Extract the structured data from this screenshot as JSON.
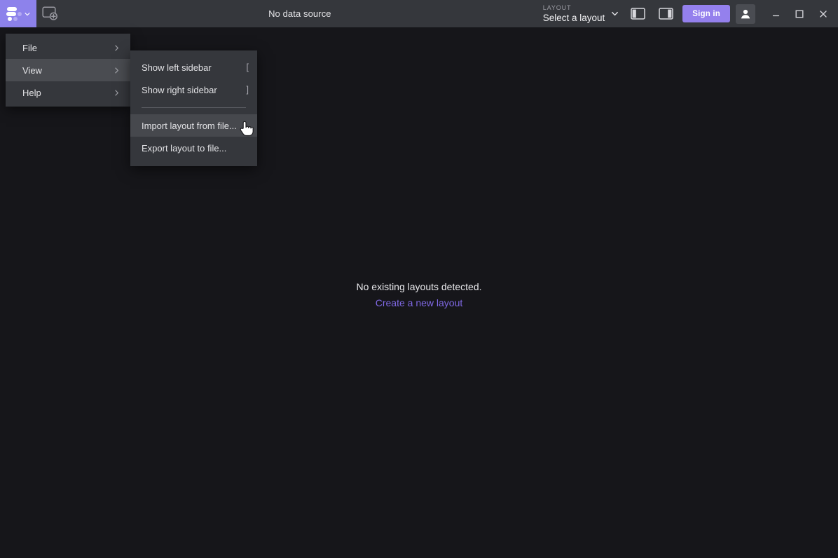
{
  "app": {
    "logo_icon": "foxglove-dots-logo",
    "logo_caret_icon": "chevron-down-icon",
    "add_panel_icon": "add-panel-icon",
    "data_source_status": "No data source"
  },
  "topbar": {
    "layout_picker": {
      "label": "LAYOUT",
      "value": "Select a layout",
      "caret_icon": "chevron-down-icon"
    },
    "left_sidebar_toggle_icon": "left-sidebar-icon",
    "right_sidebar_toggle_icon": "right-sidebar-icon",
    "sign_in_label": "Sign in",
    "avatar_icon": "user-avatar-icon",
    "window_controls": {
      "minimize_icon": "minimize-icon",
      "maximize_icon": "maximize-icon",
      "close_icon": "close-icon"
    }
  },
  "main": {
    "empty_title": "No existing layouts detected.",
    "empty_link": "Create a new layout"
  },
  "menu": {
    "root_items": [
      {
        "label": "File",
        "arrow_icon": "chevron-right-icon",
        "active": false
      },
      {
        "label": "View",
        "arrow_icon": "chevron-right-icon",
        "active": true
      },
      {
        "label": "Help",
        "arrow_icon": "chevron-right-icon",
        "active": false
      }
    ],
    "submenu_items": [
      {
        "label": "Show left sidebar",
        "shortcut": "[",
        "hovered": false
      },
      {
        "label": "Show right sidebar",
        "shortcut": "]",
        "hovered": false
      },
      {
        "label": "Import layout from file...",
        "shortcut": "",
        "hovered": true
      },
      {
        "label": "Export layout to file...",
        "shortcut": "",
        "hovered": false
      }
    ]
  },
  "cursor": {
    "icon": "pointing-hand-cursor"
  },
  "colors": {
    "topbar_bg": "#35373c",
    "canvas_bg": "#16161a",
    "accent_purple": "#9480ed",
    "logo_purple": "#8d82eb",
    "link_purple": "#7f68e4",
    "menu_bg": "#35373c",
    "menu_hover": "#4a4c51"
  }
}
